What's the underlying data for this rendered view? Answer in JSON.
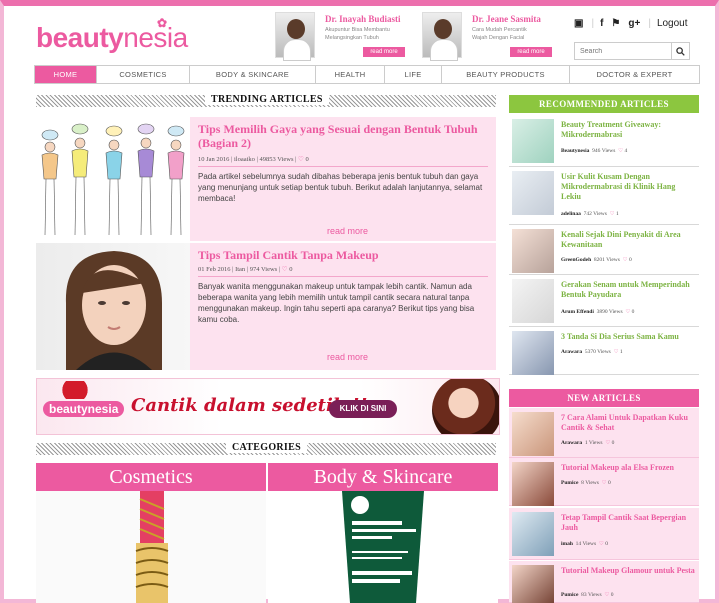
{
  "brand": {
    "logo_bold": "beauty",
    "logo_thin": "nesia",
    "pink": "#ec5aa0",
    "green": "#8cc63f"
  },
  "header": {
    "doctors": [
      {
        "name": "Dr. Inayah Budiasti",
        "desc": "Akupuntur Bisa Membantu Melangsingkan Tubuh",
        "button": "read more"
      },
      {
        "name": "Dr. Jeane Sasmita",
        "desc": "Cara Mudah Percantik Wajah Dengan Facial",
        "button": "read more"
      }
    ],
    "social_icons": [
      "instagram-icon",
      "facebook-icon",
      "twitter-icon",
      "googleplus-icon"
    ],
    "social_glyphs": [
      "▣",
      "f",
      "⚑",
      "g+"
    ],
    "logout": "Logout",
    "search_placeholder": "Search"
  },
  "nav": [
    "HOME",
    "COSMETICS",
    "BODY & SKINCARE",
    "HEALTH",
    "LIFE",
    "BEAUTY PRODUCTS",
    "DOCTOR & EXPERT"
  ],
  "trending": {
    "title": "TRENDING ARTICLES",
    "articles": [
      {
        "title": "Tips Memilih Gaya yang Sesuai dengan Bentuk Tubuh (Bagian 2)",
        "date": "10 Jan 2016",
        "author": "iloaaiko",
        "views": "49853 Views",
        "likes": "0",
        "excerpt": "Pada artikel sebelumnya sudah dibahas beberapa jenis bentuk tubuh dan gaya yang menunjang untuk setiap bentuk tubuh. Berikut adalah lanjutannya, selamat membaca!",
        "more": "read more"
      },
      {
        "title": "Tips Tampil Cantik Tanpa Makeup",
        "date": "01 Feb 2016",
        "author": "Itan",
        "views": "974 Views",
        "likes": "0",
        "excerpt": "Banyak wanita menggunakan makeup untuk tampak lebih cantik. Namun ada beberapa wanita yang lebih memilih untuk tampil cantik secara natural tanpa menggunakan makeup. Ingin tahu seperti apa caranya? Berikut tips yang bisa kamu coba.",
        "more": "read more"
      }
    ]
  },
  "banner": {
    "logo": "beautynesia",
    "text": "Cantik dalam sedetik !!",
    "button": "KLIK DI SINI"
  },
  "categories": {
    "title": "CATEGORIES",
    "items": [
      "Cosmetics",
      "Body & Skincare"
    ]
  },
  "recommended": {
    "title": "RECOMMENDED ARTICLES",
    "items": [
      {
        "title": "Beauty Treatment Giveaway: Mikrodermabrasi",
        "author": "Beautynesia",
        "views": "946 Views",
        "likes": "4"
      },
      {
        "title": "Usir Kulit Kusam Dengan Mikrodermabrasi di Klinik Hang Lekiu",
        "author": "adelinaa",
        "views": "742 Views",
        "likes": "1"
      },
      {
        "title": "Kenali Sejak Dini Penyakit di Area Kewanitaan",
        "author": "GreenGodeh",
        "views": "8201 Views",
        "likes": "0"
      },
      {
        "title": "Gerakan Senam untuk Memperindah Bentuk Payudara",
        "author": "Arum Effendi",
        "views": "3890 Views",
        "likes": "0"
      },
      {
        "title": "3 Tanda Si Dia Serius Sama Kamu",
        "author": "Arawara",
        "views": "5370 Views",
        "likes": "1"
      }
    ]
  },
  "new_articles": {
    "title": "NEW ARTICLES",
    "items": [
      {
        "title": "7 Cara Alami Untuk Dapatkan Kuku Cantik & Sehat",
        "author": "Arawara",
        "views": "1 Views",
        "likes": "0"
      },
      {
        "title": "Tutorial Makeup ala Elsa Frozen",
        "author": "Pumice",
        "views": "8 Views",
        "likes": "0"
      },
      {
        "title": "Tetap Tampil Cantik Saat Bepergian Jauh",
        "author": "imah",
        "views": "14 Views",
        "likes": "0"
      },
      {
        "title": "Tutorial Makeup Glamour untuk Pesta",
        "author": "Pumice",
        "views": "83 Views",
        "likes": "0"
      }
    ]
  }
}
